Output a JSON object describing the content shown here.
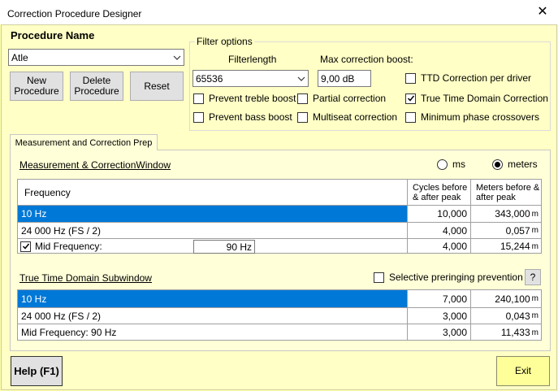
{
  "window": {
    "title": "Correction Procedure Designer",
    "close_glyph": "✕"
  },
  "procedure": {
    "heading": "Procedure Name",
    "selected": "Atle",
    "new_label": "New Procedure",
    "delete_label": "Delete Procedure",
    "reset_label": "Reset"
  },
  "filter_options": {
    "legend": "Filter options",
    "filterlength_label": "Filterlength",
    "filterlength_value": "65536",
    "max_boost_label": "Max correction boost:",
    "max_boost_value": "9,00 dB",
    "checkboxes": [
      {
        "label": "Prevent treble boost",
        "checked": false
      },
      {
        "label": "Partial correction",
        "checked": false
      },
      {
        "label": "TTD Correction per driver",
        "checked": false
      },
      {
        "label": "True Time Domain Correction",
        "checked": true
      },
      {
        "label": "Prevent bass boost",
        "checked": false
      },
      {
        "label": "Multiseat correction",
        "checked": false
      },
      {
        "label": "Minimum phase crossovers",
        "checked": false
      }
    ]
  },
  "tab": {
    "label": "Measurement and Correction Prep"
  },
  "measurement_window": {
    "heading": "Measurement & CorrectionWindow",
    "radio_ms": "ms",
    "radio_meters": "meters",
    "selected_unit": "meters",
    "columns": [
      "Frequency",
      "Cycles before & after peak",
      "Meters before & after peak"
    ],
    "rows": [
      {
        "frequency": "10 Hz",
        "cycles": "10,000",
        "meters": "343,000",
        "unit": "m"
      },
      {
        "frequency": "24 000 Hz (FS / 2)",
        "cycles": "4,000",
        "meters": "0,057",
        "unit": "m"
      },
      {
        "frequency": "Mid Frequency:",
        "input": "90 Hz",
        "cycles": "4,000",
        "meters": "15,244",
        "unit": "m"
      }
    ]
  },
  "subwindow": {
    "heading": "True Time Domain Subwindow",
    "preringing_label": "Selective preringing prevention",
    "help_glyph": "?",
    "rows": [
      {
        "frequency": "10 Hz",
        "cycles": "7,000",
        "meters": "240,100",
        "unit": "m"
      },
      {
        "frequency": "24 000 Hz (FS / 2)",
        "cycles": "3,000",
        "meters": "0,043",
        "unit": "m"
      },
      {
        "frequency": "Mid Frequency: 90 Hz",
        "cycles": "3,000",
        "meters": "11,433",
        "unit": "m"
      }
    ]
  },
  "footer": {
    "help_label": "Help (F1)",
    "exit_label": "Exit"
  },
  "colors": {
    "selection": "#0078d7",
    "background": "#ffffc6",
    "exit_button": "#ffff99"
  }
}
